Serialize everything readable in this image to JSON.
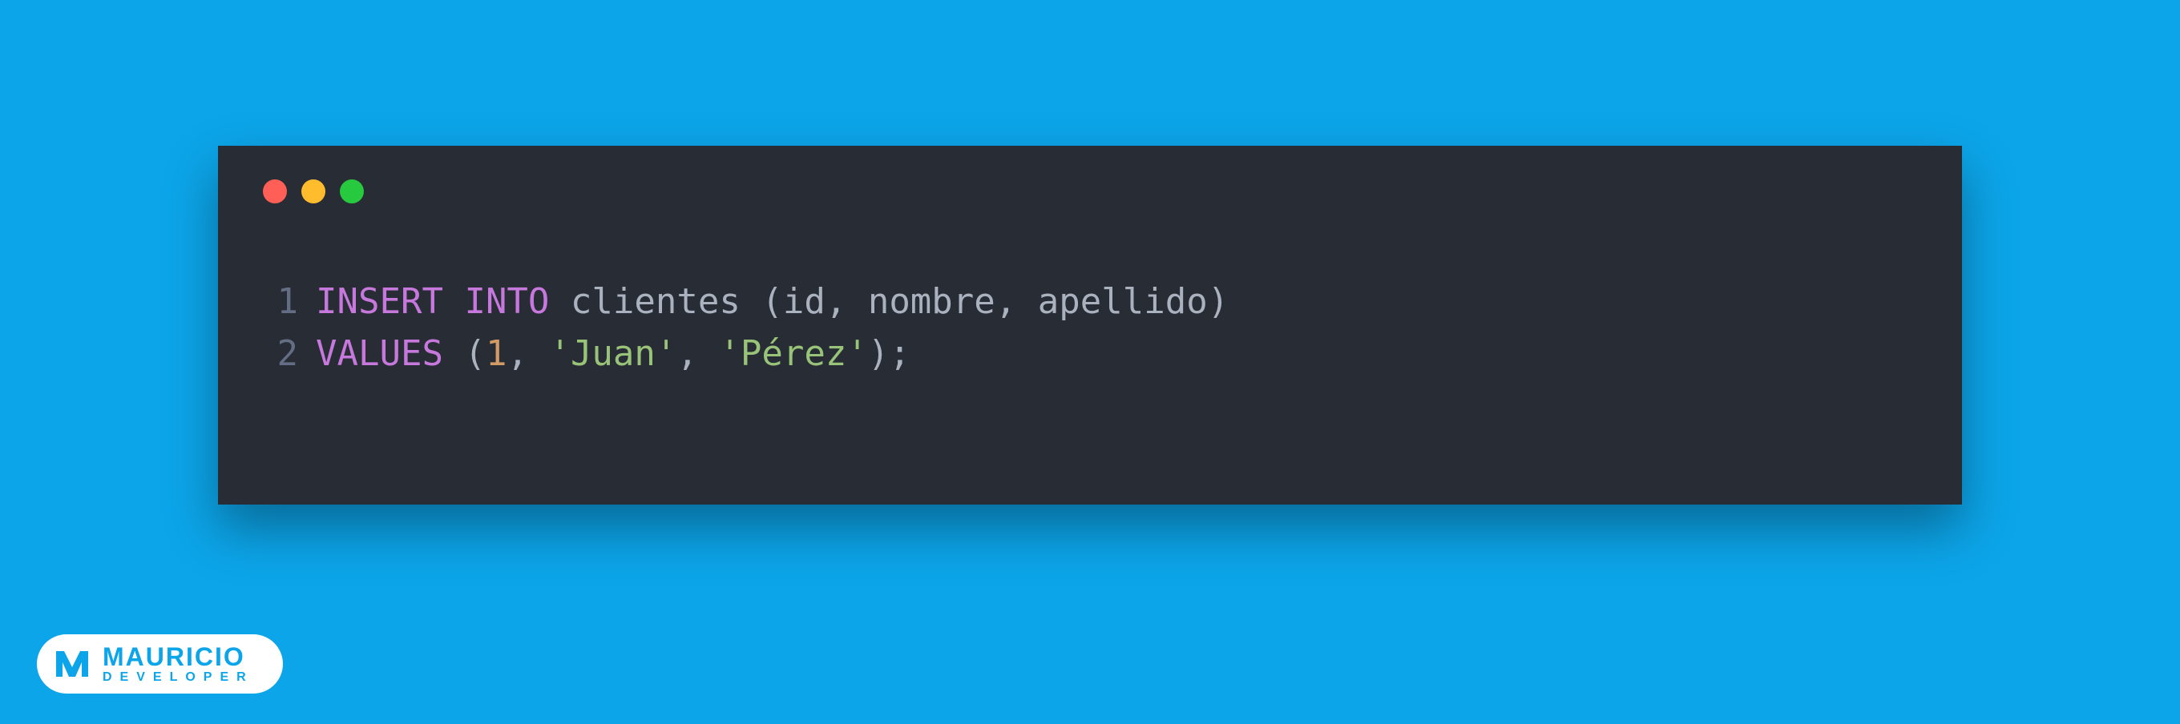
{
  "code": {
    "line_numbers": [
      "1",
      "2"
    ],
    "line1": {
      "kw1": "INSERT",
      "kw2": "INTO",
      "table": "clientes",
      "open_paren": "(",
      "col1": "id",
      "comma1": ",",
      "col2": "nombre",
      "comma2": ",",
      "col3": "apellido",
      "close_paren": ")"
    },
    "line2": {
      "kw": "VALUES",
      "open_paren": "(",
      "val1": "1",
      "comma1": ",",
      "val2": "'Juan'",
      "comma2": ",",
      "val3": "'Pérez'",
      "close_paren": ")",
      "semi": ";"
    }
  },
  "badge": {
    "title": "MAURICIO",
    "sub": "DEVELOPER"
  }
}
